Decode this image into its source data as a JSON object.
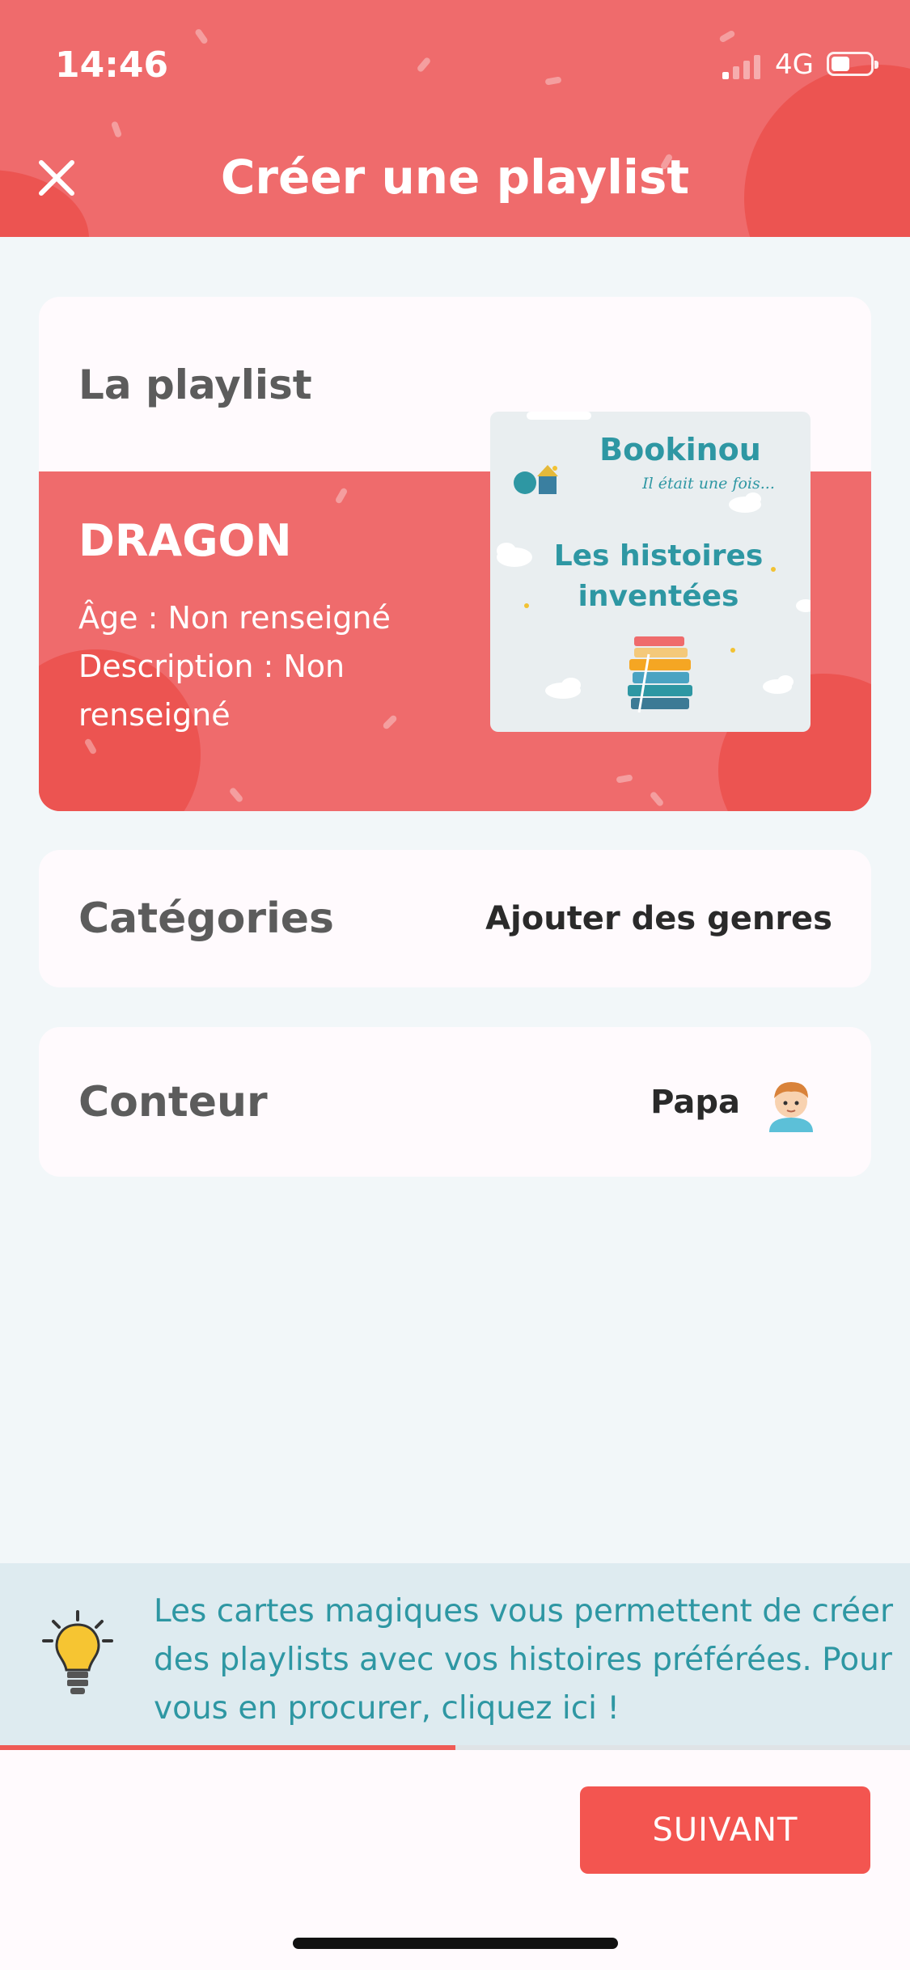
{
  "status_bar": {
    "time": "14:46",
    "network": "4G"
  },
  "header": {
    "title": "Créer une playlist"
  },
  "playlist_card": {
    "title": "La playlist",
    "name": "DRAGON",
    "age": "Âge : Non renseigné",
    "description": "Description : Non renseigné",
    "cover": {
      "brand": "Bookinou",
      "tagline": "Il était une fois...",
      "line1": "Les histoires",
      "line2": "inventées"
    }
  },
  "categories": {
    "label": "Catégories",
    "action": "Ajouter des genres"
  },
  "storyteller": {
    "label": "Conteur",
    "value": "Papa"
  },
  "tip": {
    "text": "Les cartes magiques vous permettent de créer des playlists avec vos histoires préférées. Pour vous en procurer, cliquez ici !"
  },
  "progress": {
    "fraction": 0.5
  },
  "footer": {
    "next_label": "SUIVANT"
  },
  "colors": {
    "accent": "#ef6b6c",
    "button": "#f35550",
    "teal": "#2e97a3"
  }
}
